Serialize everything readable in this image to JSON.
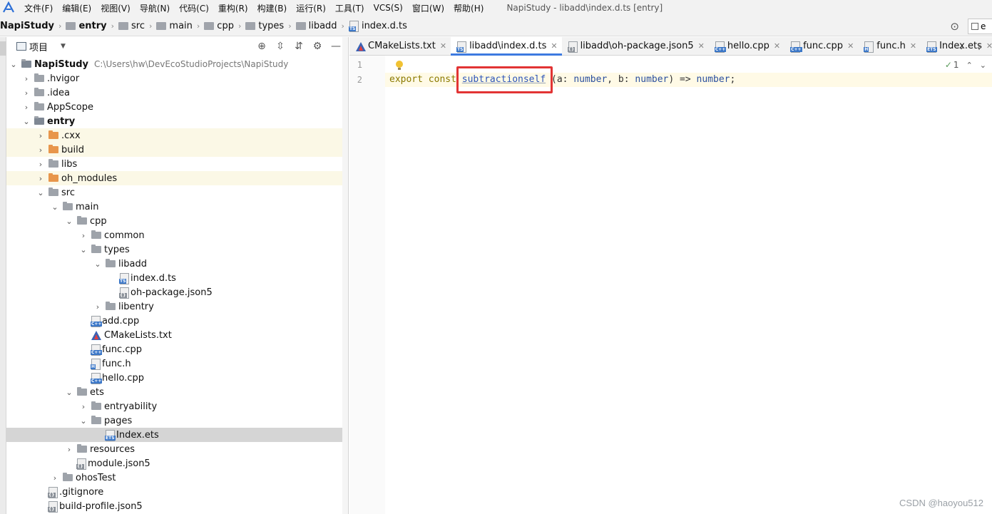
{
  "menubar": {
    "items": [
      "文件(F)",
      "编辑(E)",
      "视图(V)",
      "导航(N)",
      "代码(C)",
      "重构(R)",
      "构建(B)",
      "运行(R)",
      "工具(T)",
      "VCS(S)",
      "窗口(W)",
      "帮助(H)"
    ],
    "window_title": "NapiStudy - libadd\\index.d.ts [entry]"
  },
  "navbar": {
    "crumbs": [
      "NapiStudy",
      "entry",
      "src",
      "main",
      "cpp",
      "types",
      "libadd",
      "index.d.ts"
    ],
    "run_config": "e"
  },
  "project_panel": {
    "title": "项目",
    "root_name": "NapiStudy",
    "root_path": "C:\\Users\\hw\\DevEcoStudioProjects\\NapiStudy",
    "rows": [
      {
        "label": ".hvigor"
      },
      {
        "label": ".idea"
      },
      {
        "label": "AppScope"
      },
      {
        "label": "entry"
      },
      {
        "label": ".cxx"
      },
      {
        "label": "build"
      },
      {
        "label": "libs"
      },
      {
        "label": "oh_modules"
      },
      {
        "label": "src"
      },
      {
        "label": "main"
      },
      {
        "label": "cpp"
      },
      {
        "label": "common"
      },
      {
        "label": "types"
      },
      {
        "label": "libadd"
      },
      {
        "label": "index.d.ts"
      },
      {
        "label": "oh-package.json5"
      },
      {
        "label": "libentry"
      },
      {
        "label": "add.cpp"
      },
      {
        "label": "CMakeLists.txt"
      },
      {
        "label": "func.cpp"
      },
      {
        "label": "func.h"
      },
      {
        "label": "hello.cpp"
      },
      {
        "label": "ets"
      },
      {
        "label": "entryability"
      },
      {
        "label": "pages"
      },
      {
        "label": "Index.ets"
      },
      {
        "label": "resources"
      },
      {
        "label": "module.json5"
      },
      {
        "label": "ohosTest"
      },
      {
        "label": ".gitignore"
      },
      {
        "label": "build-profile.json5"
      }
    ]
  },
  "editor": {
    "tabs": [
      "CMakeLists.txt",
      "libadd\\index.d.ts",
      "libadd\\oh-package.json5",
      "hello.cpp",
      "func.cpp",
      "func.h",
      "Index.ets"
    ],
    "line_numbers": [
      "1",
      "2"
    ],
    "code": {
      "kw_export": "export",
      "kw_const": "const",
      "ident": "subtractionself",
      "rest_open": " (a: ",
      "type1": "number",
      "rest_mid": ", b: ",
      "type2": "number",
      "rest_arrow": ") => ",
      "type3": "number",
      "rest_end": ";"
    },
    "inspection_count": "1"
  },
  "watermark": "CSDN @haoyou512"
}
